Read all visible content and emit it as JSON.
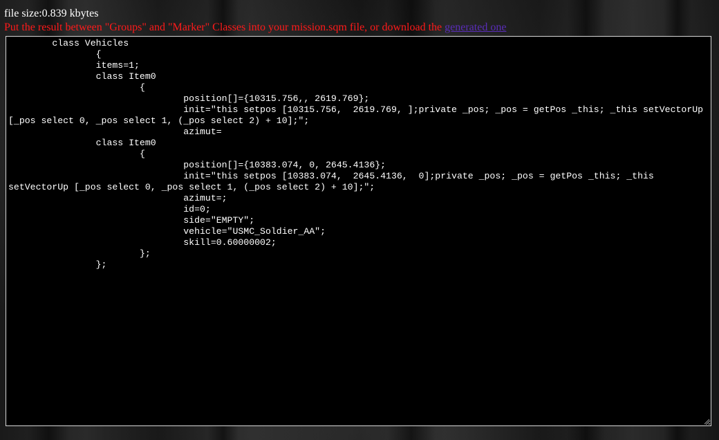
{
  "header": {
    "file_size_text": "file size:0.839 kbytes",
    "instruction_text": "Put the result between \"Groups\" and \"Marker\" Classes into your mission.sqm file, or download the ",
    "download_link_label": "generated one"
  },
  "output": {
    "code": "        class Vehicles\n                {\n                items=1;\n                class Item0\n                        {\n                                position[]={10315.756,, 2619.769};\n                                init=\"this setpos [10315.756,  2619.769, ];private _pos; _pos = getPos _this; _this setVectorUp [_pos select 0, _pos select 1, (_pos select 2) + 10];\";\n                                azimut=\n                class Item0\n                        {\n                                position[]={10383.074, 0, 2645.4136};\n                                init=\"this setpos [10383.074,  2645.4136,  0];private _pos; _pos = getPos _this; _this setVectorUp [_pos select 0, _pos select 1, (_pos select 2) + 10];\";\n                                azimut=;\n                                id=0;\n                                side=\"EMPTY\";\n                                vehicle=\"USMC_Soldier_AA\";\n                                skill=0.60000002;\n                        };\n                };"
  },
  "colors": {
    "instruction": "#ff1a1a",
    "link": "#5a2db8",
    "code_background": "#000000",
    "code_text": "#ffffff"
  }
}
